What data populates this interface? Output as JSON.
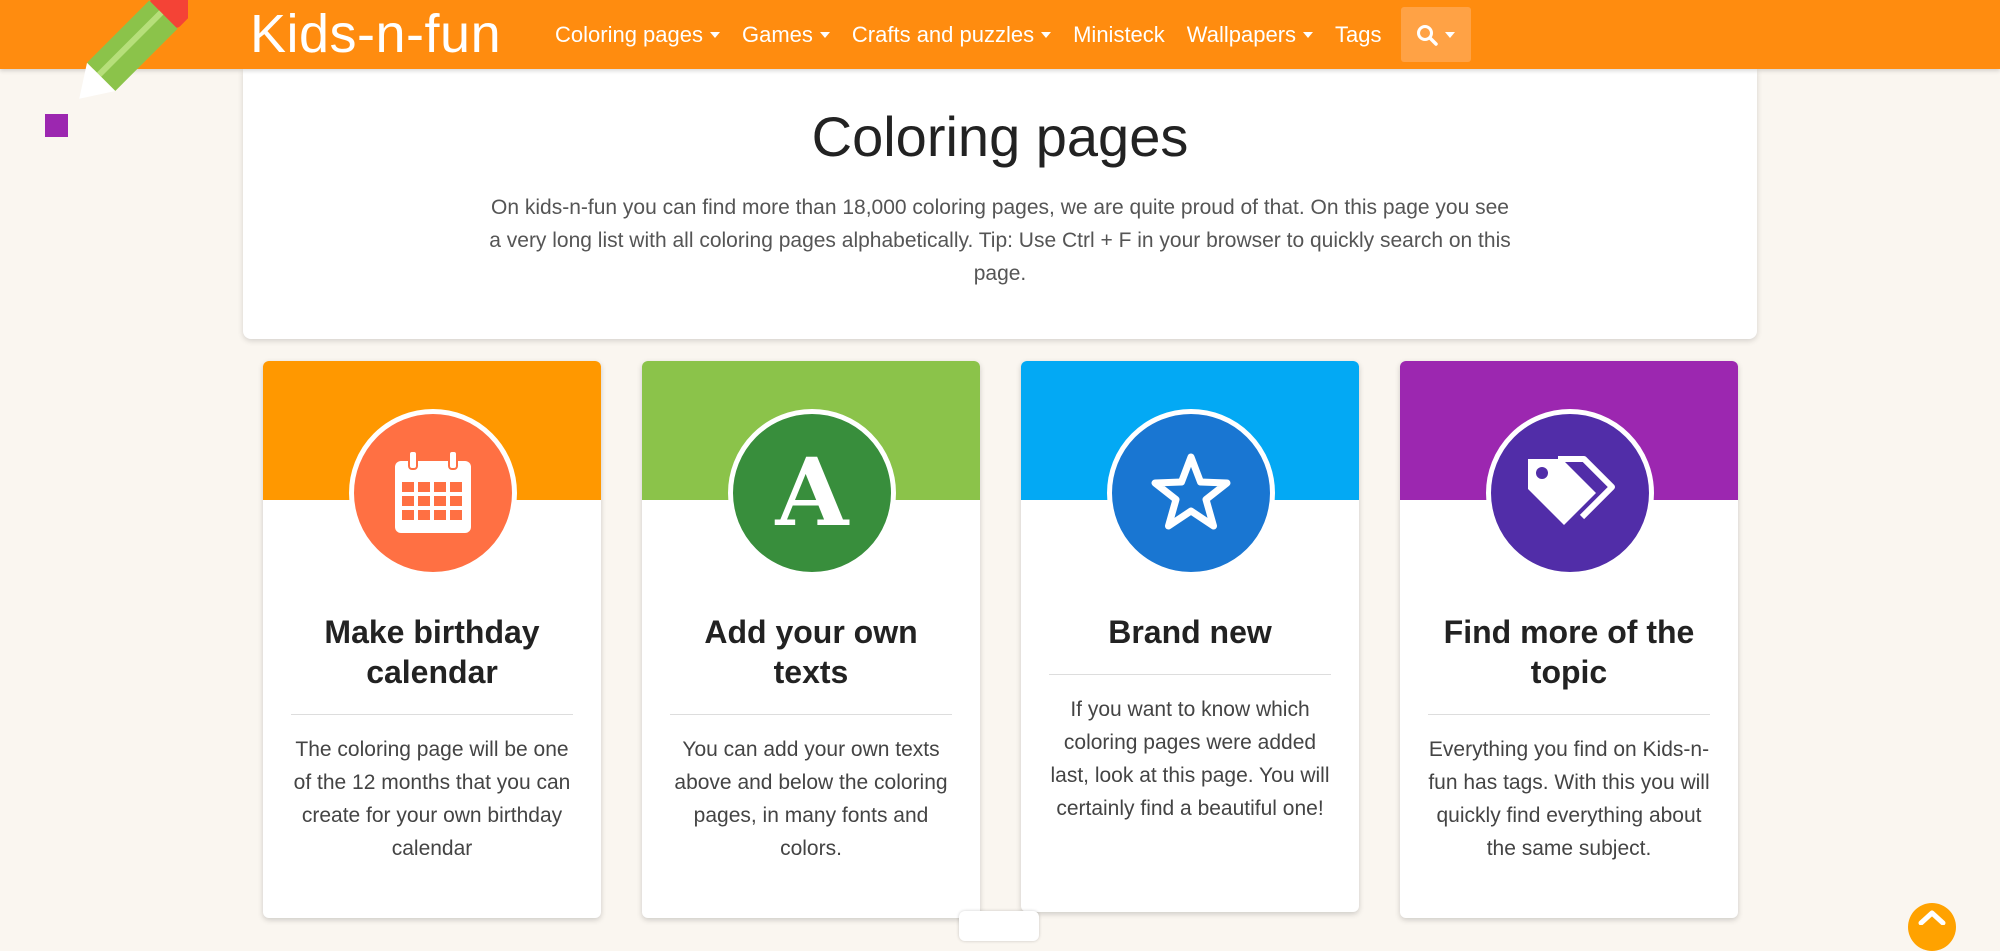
{
  "brand": {
    "name": "Kids-n-fun"
  },
  "nav": {
    "items": [
      {
        "label": "Coloring pages",
        "dropdown": true
      },
      {
        "label": "Games",
        "dropdown": true
      },
      {
        "label": "Crafts and puzzles",
        "dropdown": true
      },
      {
        "label": "Ministeck",
        "dropdown": false
      },
      {
        "label": "Wallpapers",
        "dropdown": true
      },
      {
        "label": "Tags",
        "dropdown": false
      }
    ],
    "search_icon": "search-icon"
  },
  "intro": {
    "title": "Coloring pages",
    "text": "On kids-n-fun you can find more than 18,000 coloring pages, we are quite proud of that. On this page you see a very long list with all coloring pages alphabetically. Tip: Use Ctrl + F in your browser to quickly search on this page."
  },
  "cards": [
    {
      "title": "Make birthday calendar",
      "text": "The coloring page will be one of the 12 months that you can create for your own birthday calendar",
      "icon": "calendar-icon",
      "top_color": "#ff9800",
      "circle_color": "#ff7043"
    },
    {
      "title": "Add your own texts",
      "text": "You can add your own texts above and below the coloring pages, in many fonts and colors.",
      "icon": "letter-a-icon",
      "icon_text": "A",
      "top_color": "#8bc34a",
      "circle_color": "#388e3c"
    },
    {
      "title": "Brand new",
      "text": "If you want to know which coloring pages were added last, look at this page. You will certainly find a beautiful one!",
      "icon": "star-icon",
      "top_color": "#03a9f4",
      "circle_color": "#1976d2"
    },
    {
      "title": "Find more of the topic",
      "text": "Everything you find on Kids-n-fun has tags. With this you will quickly find everything about the same subject.",
      "icon": "tags-icon",
      "top_color": "#9c27b0",
      "circle_color": "#512da8"
    }
  ],
  "colors": {
    "nav_bg": "#ff8c0f",
    "page_bg": "#faf6f0"
  }
}
